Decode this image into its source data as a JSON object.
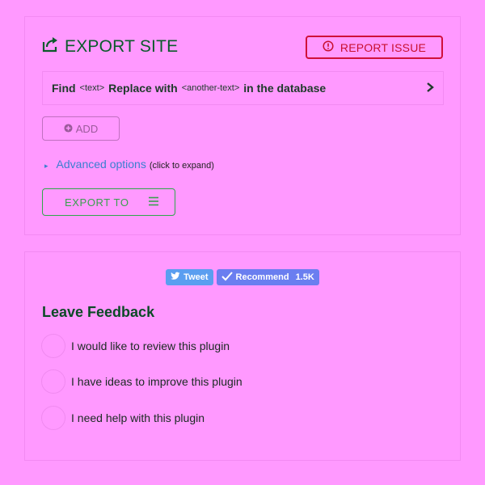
{
  "export": {
    "title": "EXPORT SITE",
    "report_label": "REPORT ISSUE",
    "find_row": {
      "find": "Find",
      "text_token": "<text>",
      "replace": "Replace with",
      "another_token": "<another-text>",
      "suffix": "in the database"
    },
    "add_label": "ADD",
    "advanced_link": "Advanced options",
    "advanced_hint": "(click to expand)",
    "export_to_label": "EXPORT TO"
  },
  "social": {
    "tweet_label": "Tweet",
    "recommend_label": "Recommend",
    "recommend_count": "1.5K"
  },
  "feedback": {
    "title": "Leave Feedback",
    "options": [
      {
        "label": "I would like to review this plugin"
      },
      {
        "label": "I have ideas to improve this plugin"
      },
      {
        "label": "I need help with this plugin"
      }
    ]
  },
  "colors": {
    "background": "#ff99ff",
    "report_accent": "#c8102e",
    "export_to_accent": "#3aa04e",
    "link": "#3a7fd0",
    "tweet": "#5a9ef0",
    "recommend": "#6a7ef0"
  },
  "icons": {
    "export": "share-export-icon",
    "report": "alert-circle-icon",
    "chevron": "chevron-right-icon",
    "add": "plus-circle-icon",
    "caret": "caret-right-icon",
    "menu": "hamburger-menu-icon",
    "twitter": "twitter-bird-icon",
    "check": "checkmark-icon"
  }
}
